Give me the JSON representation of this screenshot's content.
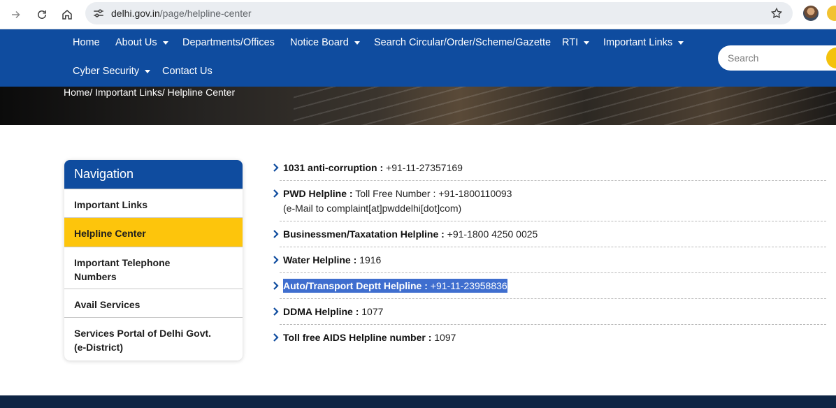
{
  "browser": {
    "url_host": "delhi.gov.in",
    "url_path": "/page/helpline-center"
  },
  "nav": {
    "items": [
      {
        "label": "Home"
      },
      {
        "label": "About Us"
      },
      {
        "label": "Departments/Offices"
      },
      {
        "label": "Notice Board"
      },
      {
        "label": "Search Circular/Order/Scheme/Gazette"
      },
      {
        "label": "RTI"
      },
      {
        "label": "Important Links"
      },
      {
        "label": "Cyber Security"
      },
      {
        "label": "Contact Us"
      }
    ],
    "search_placeholder": "Search"
  },
  "breadcrumb": "Home/ Important Links/ Helpline Center",
  "sidebar": {
    "title": "Navigation",
    "items": [
      {
        "line1": "Important Links",
        "line2": ""
      },
      {
        "line1": "Helpline Center",
        "line2": ""
      },
      {
        "line1": "Important Telephone",
        "line2": "Numbers"
      },
      {
        "line1": "Avail Services",
        "line2": ""
      },
      {
        "line1": "Services Portal of Delhi Govt.",
        "line2": "(e-District)"
      }
    ]
  },
  "helplines": [
    {
      "name": "1031 anti-corruption :",
      "value": " +91-11-27357169",
      "extra": ""
    },
    {
      "name": "PWD Helpline :",
      "value": " Toll Free Number : +91-1800110093",
      "extra": "(e-Mail to complaint[at]pwddelhi[dot]com)"
    },
    {
      "name": "Businessmen/Taxatation Helpline :",
      "value": " +91-1800 4250 0025",
      "extra": ""
    },
    {
      "name": "Water Helpline :",
      "value": " 1916",
      "extra": ""
    },
    {
      "name": "Auto/Transport Deptt Helpline :",
      "value": " +91-11-23958836",
      "extra": ""
    },
    {
      "name": "DDMA Helpline :",
      "value": " 1077",
      "extra": ""
    },
    {
      "name": "Toll free AIDS Helpline number :",
      "value": " 1097",
      "extra": ""
    }
  ],
  "colors": {
    "nav_bg": "#0f4c9f",
    "active_item": "#fdc50c",
    "selection": "#3f6ecf"
  }
}
